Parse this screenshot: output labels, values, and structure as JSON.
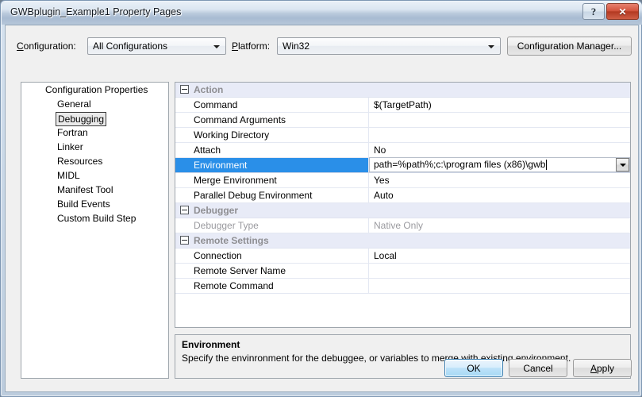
{
  "window": {
    "title": "GWBplugin_Example1 Property Pages",
    "help_button": "?",
    "close_button": "✕",
    "help_icon": "question-mark-icon",
    "close_icon": "close-x-icon"
  },
  "toolbar": {
    "configuration_label_pre": "C",
    "configuration_label_post": "onfiguration:",
    "configuration_value": "All Configurations",
    "platform_label_pre": "P",
    "platform_label_post": "latform:",
    "platform_value": "Win32",
    "configuration_manager_label": "Configuration Manager..."
  },
  "tree": {
    "root": "Configuration Properties",
    "items": [
      {
        "label": "General",
        "selected": false
      },
      {
        "label": "Debugging",
        "selected": true
      },
      {
        "label": "Fortran",
        "selected": false
      },
      {
        "label": "Linker",
        "selected": false
      },
      {
        "label": "Resources",
        "selected": false
      },
      {
        "label": "MIDL",
        "selected": false
      },
      {
        "label": "Manifest Tool",
        "selected": false
      },
      {
        "label": "Build Events",
        "selected": false
      },
      {
        "label": "Custom Build Step",
        "selected": false
      }
    ]
  },
  "grid": {
    "categories": [
      {
        "name": "Action",
        "rows": [
          {
            "name": "Command",
            "value": "$(TargetPath)",
            "state": "normal"
          },
          {
            "name": "Command Arguments",
            "value": "",
            "state": "normal"
          },
          {
            "name": "Working Directory",
            "value": "",
            "state": "normal"
          },
          {
            "name": "Attach",
            "value": "No",
            "state": "normal"
          },
          {
            "name": "Environment",
            "value": "path=%path%;c:\\program files (x86)\\gwb",
            "state": "editing"
          },
          {
            "name": "Merge Environment",
            "value": "Yes",
            "state": "normal"
          },
          {
            "name": "Parallel Debug Environment",
            "value": "Auto",
            "state": "normal"
          }
        ]
      },
      {
        "name": "Debugger",
        "rows": [
          {
            "name": "Debugger Type",
            "value": "Native Only",
            "state": "disabled"
          }
        ]
      },
      {
        "name": "Remote Settings",
        "rows": [
          {
            "name": "Connection",
            "value": "Local",
            "state": "normal"
          },
          {
            "name": "Remote Server Name",
            "value": "",
            "state": "normal"
          },
          {
            "name": "Remote Command",
            "value": "",
            "state": "normal"
          }
        ]
      }
    ]
  },
  "description": {
    "title": "Environment",
    "body": "Specify the envinronment for the debuggee, or variables to merge with existing environment."
  },
  "buttons": {
    "ok": "OK",
    "cancel": "Cancel",
    "apply_pre": "A",
    "apply_post": "pply"
  },
  "colors": {
    "selection_blue": "#2a8fe8",
    "category_bg": "#e8ebf7",
    "close_red": "#b33a22",
    "default_button_blue": "#3c7fb1"
  }
}
